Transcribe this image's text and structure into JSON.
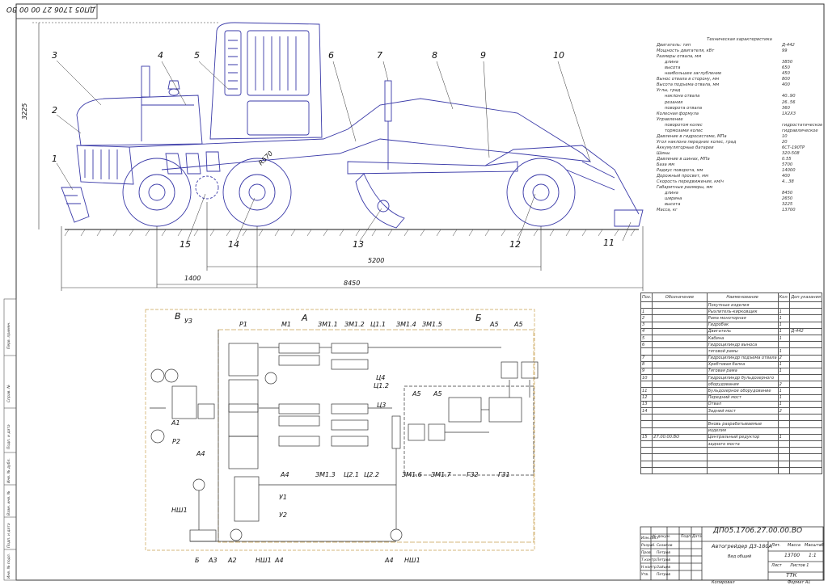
{
  "drawing_code_rotated": "ДП05 1706 27 00 00 ВО",
  "part_numbers": [
    "1",
    "2",
    "3",
    "4",
    "5",
    "6",
    "7",
    "8",
    "9",
    "10",
    "11",
    "12",
    "13",
    "14",
    "15"
  ],
  "dimensions": {
    "height": "3225",
    "wheelbase": "5200",
    "tandem": "1400",
    "overall": "8450",
    "radius": "R570"
  },
  "spec": {
    "title": "Техническая характеристика",
    "rows": [
      {
        "k": "Двигатель: тип",
        "v": "Д-442",
        "indent": false
      },
      {
        "k": "Мощность двигателя, кВт",
        "v": "99",
        "indent": false
      },
      {
        "k": "Размеры отвала, мм",
        "v": "",
        "indent": false
      },
      {
        "k": "длина",
        "v": "3850",
        "indent": true
      },
      {
        "k": "высота",
        "v": "650",
        "indent": true
      },
      {
        "k": "наибольшее заглубление",
        "v": "450",
        "indent": true
      },
      {
        "k": "Вынос отвала в сторону, мм",
        "v": "800",
        "indent": false
      },
      {
        "k": "Высота подъема отвала, мм",
        "v": "400",
        "indent": false
      },
      {
        "k": "Углы, град",
        "v": "",
        "indent": false
      },
      {
        "k": "наклона отвала",
        "v": "40..90",
        "indent": true
      },
      {
        "k": "резания",
        "v": "26..56",
        "indent": true
      },
      {
        "k": "поворота отвала",
        "v": "360",
        "indent": true
      },
      {
        "k": "Колесная формула",
        "v": "1Х2Х3",
        "indent": false
      },
      {
        "k": "Управление",
        "v": "",
        "indent": false
      },
      {
        "k": "поворотом колес",
        "v": "гидростатическое",
        "indent": true
      },
      {
        "k": "тормозами колес",
        "v": "гидравлическое",
        "indent": true
      },
      {
        "k": "Давление в гидросистеме, МПа",
        "v": "10",
        "indent": false
      },
      {
        "k": "Угол наклона передних колес, град",
        "v": "20",
        "indent": false
      },
      {
        "k": "Аккумуляторные батареи",
        "v": "6СТ-190ТР",
        "indent": false
      },
      {
        "k": "Шины",
        "v": "320-508",
        "indent": false
      },
      {
        "k": "Давление в шинах, МПа",
        "v": "0.55",
        "indent": false
      },
      {
        "k": "База мм",
        "v": "5700",
        "indent": false
      },
      {
        "k": "Радиус поворота, мм",
        "v": "14000",
        "indent": false
      },
      {
        "k": "Дорожный просвет, мм",
        "v": "400",
        "indent": false
      },
      {
        "k": "Скорость передвижения, км/ч",
        "v": "4...38",
        "indent": false
      },
      {
        "k": "Габаритные размеры, мм",
        "v": "",
        "indent": false
      },
      {
        "k": "длина",
        "v": "8450",
        "indent": true
      },
      {
        "k": "ширина",
        "v": "2650",
        "indent": true
      },
      {
        "k": "высота",
        "v": "3225",
        "indent": true
      },
      {
        "k": "Масса, кг",
        "v": "13700",
        "indent": false
      }
    ]
  },
  "bom": {
    "headers": [
      "Поз.",
      "Обозначение",
      "Наименование",
      "Кол.",
      "Доп.указания"
    ],
    "rows": [
      {
        "pos": "",
        "code": "",
        "name": "Покупные изделия",
        "qty": "",
        "note": ""
      },
      {
        "pos": "1",
        "code": "",
        "name": "Рыхлитель-кирковщик",
        "qty": "1",
        "note": ""
      },
      {
        "pos": "2",
        "code": "",
        "name": "Рама моноторная",
        "qty": "1",
        "note": ""
      },
      {
        "pos": "3",
        "code": "",
        "name": "Гидробак",
        "qty": "1",
        "note": ""
      },
      {
        "pos": "4",
        "code": "",
        "name": "Двигатель",
        "qty": "1",
        "note": "Д-442"
      },
      {
        "pos": "5",
        "code": "",
        "name": "Кабина",
        "qty": "1",
        "note": ""
      },
      {
        "pos": "6",
        "code": "",
        "name": "Гидроцилиндр выноса",
        "qty": "",
        "note": ""
      },
      {
        "pos": "",
        "code": "",
        "name": "тяговой рамы",
        "qty": "1",
        "note": ""
      },
      {
        "pos": "7",
        "code": "",
        "name": "Гидроцилиндр подъема отвала",
        "qty": "2",
        "note": ""
      },
      {
        "pos": "8",
        "code": "",
        "name": "Хребтовая балка",
        "qty": "1",
        "note": ""
      },
      {
        "pos": "9",
        "code": "",
        "name": "Тяговая рама",
        "qty": "1",
        "note": ""
      },
      {
        "pos": "10",
        "code": "",
        "name": "Гидроцилиндр бульдозерного",
        "qty": "",
        "note": ""
      },
      {
        "pos": "",
        "code": "",
        "name": "оборудования",
        "qty": "2",
        "note": ""
      },
      {
        "pos": "11",
        "code": "",
        "name": "Бульдозерное оборудование",
        "qty": "1",
        "note": ""
      },
      {
        "pos": "12",
        "code": "",
        "name": "Передний мост",
        "qty": "1",
        "note": ""
      },
      {
        "pos": "13",
        "code": "",
        "name": "Отвал",
        "qty": "1",
        "note": ""
      },
      {
        "pos": "14",
        "code": "",
        "name": "Задний мост",
        "qty": "2",
        "note": ""
      },
      {
        "pos": "",
        "code": "",
        "name": "",
        "qty": "",
        "note": ""
      },
      {
        "pos": "",
        "code": "",
        "name": "Вновь разрабатываемые",
        "qty": "",
        "note": ""
      },
      {
        "pos": "",
        "code": "",
        "name": "изделия",
        "qty": "",
        "note": ""
      },
      {
        "pos": "15",
        "code": "27.00.00.ВО",
        "name": "Центральный редуктор",
        "qty": "1",
        "note": ""
      },
      {
        "pos": "",
        "code": "",
        "name": "заднего моста",
        "qty": "",
        "note": ""
      },
      {
        "pos": "",
        "code": "",
        "name": "",
        "qty": "",
        "note": ""
      },
      {
        "pos": "",
        "code": "",
        "name": "",
        "qty": "",
        "note": ""
      },
      {
        "pos": "",
        "code": "",
        "name": "",
        "qty": "",
        "note": ""
      },
      {
        "pos": "",
        "code": "",
        "name": "",
        "qty": "",
        "note": ""
      }
    ]
  },
  "title_block": {
    "code": "ДП05.1706.27.00.00.ВО",
    "name": "Автогрейдер ДЗ-180А",
    "sub": "Вид общий",
    "stage": "Лит.",
    "mass_h": "Масса",
    "scale_h": "Масштаб",
    "mass": "13700",
    "scale": "1:1",
    "sheet": "Лист",
    "sheets": "Листов 1",
    "org": "ТТК",
    "copied": "Копировал",
    "format": "Формат  А1",
    "roles": [
      "Изм.Лист",
      "№ докум.",
      "Подп.",
      "Дата",
      "Разраб.",
      "Пров.",
      "Т.контр.",
      "Н.контр.",
      "Утв."
    ],
    "people": [
      "Сизиков",
      "Петров",
      "Петров",
      "Зайцев",
      "Петров"
    ]
  },
  "schematic": {
    "zones": [
      "В",
      "А",
      "Б"
    ],
    "labels": [
      "У3",
      "Р1",
      "М1",
      "ЗМ1.1",
      "ЗМ1.2",
      "Ц1.1",
      "ЗМ1.4",
      "ЗМ1.5",
      "А5",
      "А5",
      "Ц4",
      "Ц1.2",
      "Ц3",
      "А5",
      "А5",
      "А1",
      "Р2",
      "А4",
      "ЗМ1.3",
      "Ц2.1",
      "Ц2.2",
      "ЗМ1.6",
      "ЗМ1.7",
      "Г32",
      "Г31",
      "А4",
      "У1",
      "У2",
      "НШ1",
      "Б",
      "А3",
      "А2",
      "НШ1",
      "А4",
      "А4",
      "НШ1"
    ]
  },
  "side_stamps": [
    "Перв. примен.",
    "Справ. №",
    "Подп. и дата",
    "Инв. № дубл.",
    "Взам. инв. №",
    "Подп. и дата",
    "Инв. № подл."
  ]
}
